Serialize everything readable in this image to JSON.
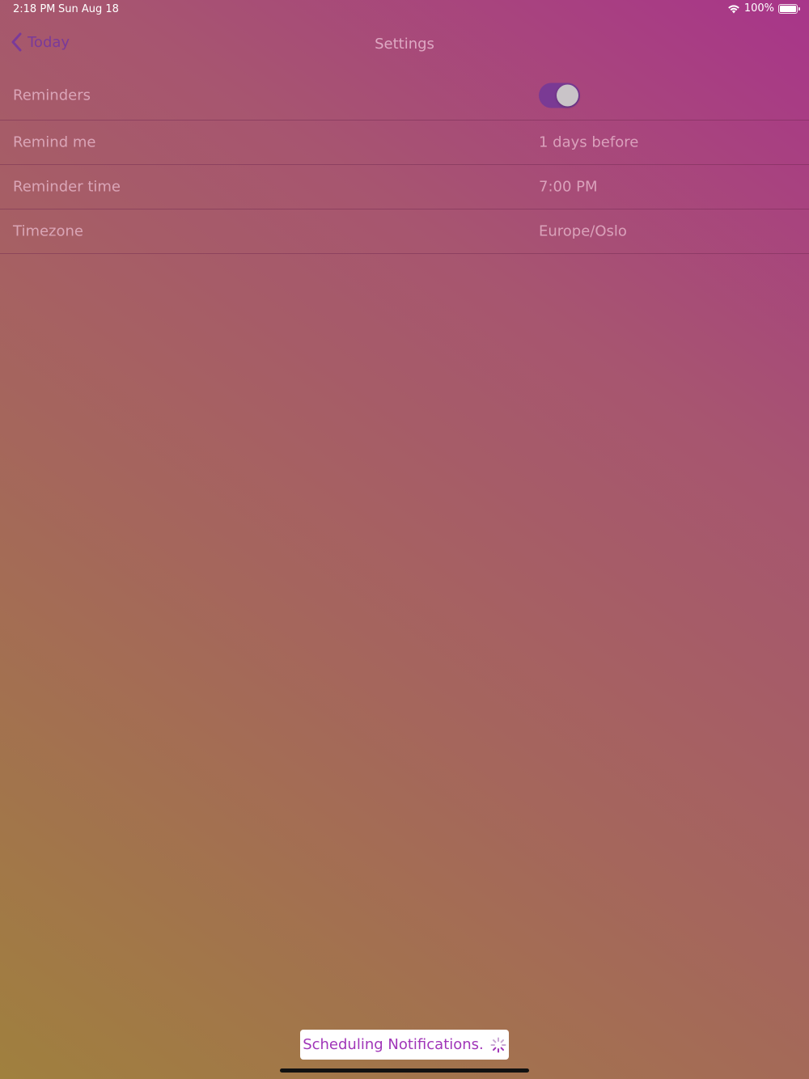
{
  "status_bar": {
    "time": "2:18 PM",
    "date": "Sun Aug 18",
    "battery": "100%",
    "icons": [
      "wifi-icon",
      "battery-icon"
    ]
  },
  "nav": {
    "back_label": "Today",
    "title": "Settings"
  },
  "settings": {
    "reminders_label": "Reminders",
    "reminders_enabled": true,
    "remind_me_label": "Remind me",
    "remind_me_value": "1 days before",
    "reminder_time_label": "Reminder time",
    "reminder_time_value": "7:00 PM",
    "timezone_label": "Timezone",
    "timezone_value": "Europe/Oslo"
  },
  "toast": {
    "message": "Scheduling Notifications."
  },
  "colors": {
    "accent": "#7a3a94",
    "toast_text": "#a035b8",
    "back_link": "#7a3a9a"
  }
}
